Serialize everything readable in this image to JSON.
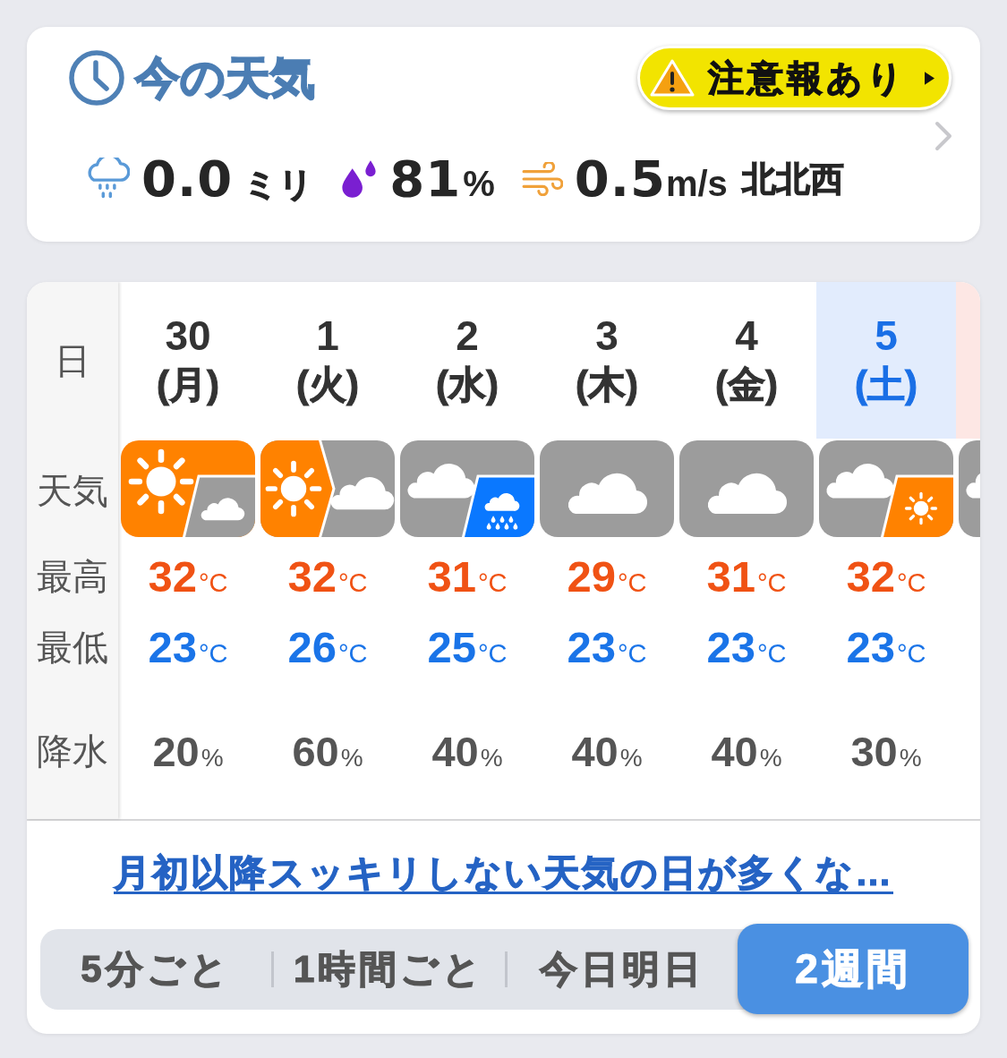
{
  "current": {
    "title": "今の天気",
    "alert": {
      "label": "注意報あり"
    },
    "readings": [
      {
        "kind": "rain",
        "value": "0.0",
        "unit": "ミリ"
      },
      {
        "kind": "humidity",
        "value": "81",
        "unit": "%"
      },
      {
        "kind": "wind",
        "value": "0.5",
        "unit": "m/s",
        "direction": "北北西"
      }
    ]
  },
  "forecast": {
    "row_labels": {
      "date": "日",
      "weather": "天気",
      "high": "最高",
      "low": "最低",
      "precip": "降水"
    },
    "days": [
      {
        "date": "30",
        "weekday": "(月)",
        "kind": "weekday",
        "weather": {
          "kind": "occasionally",
          "parts": [
            {
              "kind": "sunny"
            },
            {
              "kind": "cloudy"
            }
          ]
        },
        "high": {
          "value": "32",
          "unit": "°C"
        },
        "low": {
          "value": "23",
          "unit": "°C"
        },
        "precip": {
          "value": "20",
          "unit": "%"
        }
      },
      {
        "date": "1",
        "weekday": "(火)",
        "kind": "weekday",
        "weather": {
          "kind": "later",
          "parts": [
            {
              "kind": "sunny"
            },
            {
              "kind": "cloudy"
            }
          ]
        },
        "high": {
          "value": "32",
          "unit": "°C"
        },
        "low": {
          "value": "26",
          "unit": "°C"
        },
        "precip": {
          "value": "60",
          "unit": "%"
        }
      },
      {
        "date": "2",
        "weekday": "(水)",
        "kind": "weekday",
        "weather": {
          "kind": "occasionally",
          "parts": [
            {
              "kind": "cloudy"
            },
            {
              "kind": "rain"
            }
          ]
        },
        "high": {
          "value": "31",
          "unit": "°C"
        },
        "low": {
          "value": "25",
          "unit": "°C"
        },
        "precip": {
          "value": "40",
          "unit": "%"
        }
      },
      {
        "date": "3",
        "weekday": "(木)",
        "kind": "weekday",
        "weather": {
          "kind": "single",
          "parts": [
            {
              "kind": "cloudy"
            }
          ]
        },
        "high": {
          "value": "29",
          "unit": "°C"
        },
        "low": {
          "value": "23",
          "unit": "°C"
        },
        "precip": {
          "value": "40",
          "unit": "%"
        }
      },
      {
        "date": "4",
        "weekday": "(金)",
        "kind": "weekday",
        "weather": {
          "kind": "single",
          "parts": [
            {
              "kind": "cloudy"
            }
          ]
        },
        "high": {
          "value": "31",
          "unit": "°C"
        },
        "low": {
          "value": "23",
          "unit": "°C"
        },
        "precip": {
          "value": "40",
          "unit": "%"
        }
      },
      {
        "date": "5",
        "weekday": "(土)",
        "kind": "saturday",
        "weather": {
          "kind": "occasionally",
          "parts": [
            {
              "kind": "cloudy"
            },
            {
              "kind": "sunny"
            }
          ]
        },
        "high": {
          "value": "32",
          "unit": "°C"
        },
        "low": {
          "value": "23",
          "unit": "°C"
        },
        "precip": {
          "value": "30",
          "unit": "%"
        }
      },
      {
        "kind": "sunday",
        "weather": {
          "kind": "occasionally",
          "parts": [
            {
              "kind": "cloudy"
            }
          ]
        }
      }
    ]
  },
  "headline": "月初以降スッキリしない天気の日が多くな…",
  "tabs": [
    {
      "label": "5分ごと",
      "selected": false
    },
    {
      "label": "1時間ごと",
      "selected": false
    },
    {
      "label": "今日明日",
      "selected": false
    },
    {
      "label": "2週間",
      "selected": true
    }
  ]
}
